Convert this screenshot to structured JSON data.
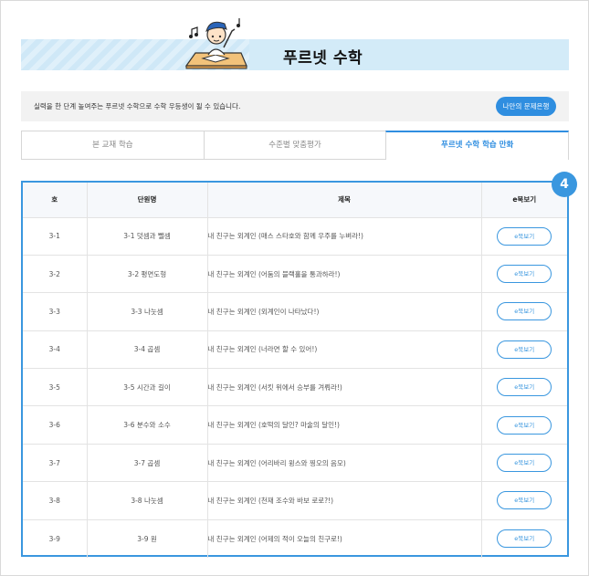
{
  "header": {
    "title": "푸르넷 수학"
  },
  "description": {
    "text": "실력을 한 단계 높여주는 푸르넷 수학으로 수학 우등생이 될 수 있습니다.",
    "run_button": "나만의 문제은행"
  },
  "tabs": [
    {
      "label": "본 교재 학습",
      "active": false
    },
    {
      "label": "수준별 맞춤평가",
      "active": false
    },
    {
      "label": "푸르넷 수학 학습 만화",
      "active": true
    }
  ],
  "badge": "4",
  "table": {
    "columns": [
      "호",
      "단원명",
      "제목",
      "e북보기"
    ],
    "rows": [
      {
        "no": "3-1",
        "unit": "3-1 덧셈과 뺄셈",
        "title": "내 친구는 외계인 (매스 스타호와 함께 우주를 누벼라!)",
        "button": "e북보기"
      },
      {
        "no": "3-2",
        "unit": "3-2 평면도형",
        "title": "내 친구는 외계인 (어둠의 블랙홀을 통과하라!)",
        "button": "e북보기"
      },
      {
        "no": "3-3",
        "unit": "3-3 나눗셈",
        "title": "내 친구는 외계인 (외계인이 나타났다!)",
        "button": "e북보기"
      },
      {
        "no": "3-4",
        "unit": "3-4 곱셈",
        "title": "내 친구는 외계인 (너라면 할 수 있어!)",
        "button": "e북보기"
      },
      {
        "no": "3-5",
        "unit": "3-5 시간과 길이",
        "title": "내 친구는 외계인 (서킷 위에서 승부를 겨뤄라!)",
        "button": "e북보기"
      },
      {
        "no": "3-6",
        "unit": "3-6 분수와 소수",
        "title": "내 친구는 외계인 (호떡의 달인? 마술의 달인!)",
        "button": "e북보기"
      },
      {
        "no": "3-7",
        "unit": "3-7 곱셈",
        "title": "내 친구는 외계인 (어리바리 윙스와 찡오의 음모)",
        "button": "e북보기"
      },
      {
        "no": "3-8",
        "unit": "3-8 나눗셈",
        "title": "내 친구는 외계인 (천재 조수와 바보 로로?!)",
        "button": "e북보기"
      },
      {
        "no": "3-9",
        "unit": "3-9 원",
        "title": "내 친구는 외계인 (어제의 적이 오늘의 친구로!)",
        "button": "e북보기"
      }
    ]
  },
  "colors": {
    "accent": "#3a97df",
    "banner": "#d3ebf8",
    "run_button": "#2f8ee0"
  },
  "icons": [
    "mascot-illustration",
    "music-note-icon"
  ]
}
